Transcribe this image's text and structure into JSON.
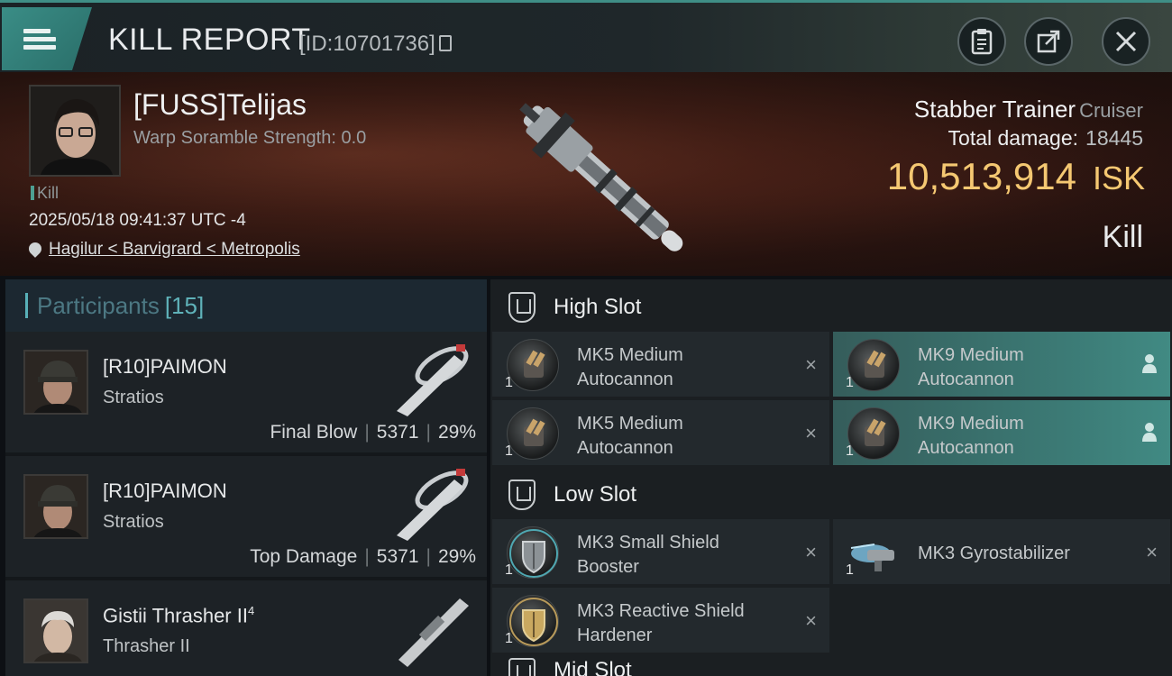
{
  "header": {
    "title": "KILL REPORT",
    "kill_id": "[ID:10701736]"
  },
  "victim": {
    "name": "[FUSS]Telijas",
    "warp_scramble": "Warp Soramble Strength: 0.0",
    "tag": "Kill",
    "time": "2025/05/18 09:41:37 UTC -4",
    "location": "Hagilur < Barvigrard < Metropolis",
    "ship_name": "Stabber Trainer",
    "ship_class": "Cruiser",
    "total_damage_label": "Total damage:",
    "total_damage": "18445",
    "isk_value": "10,513,914",
    "isk_unit": "ISK",
    "result": "Kill"
  },
  "participants": {
    "label": "Participants",
    "count": "[15]",
    "rows": [
      {
        "name": "[R10]PAIMON",
        "ship": "Stratios",
        "role": "Final Blow",
        "damage": "5371",
        "percent": "29%"
      },
      {
        "name": "[R10]PAIMON",
        "ship": "Stratios",
        "role": "Top Damage",
        "damage": "5371",
        "percent": "29%"
      },
      {
        "name": "Gistii Thrasher II",
        "sup": "4",
        "ship": "Thrasher II"
      }
    ]
  },
  "fitting": {
    "high_slot_label": "High Slot",
    "low_slot_label": "Low Slot",
    "mid_slot_label": "Mid Slot",
    "high": [
      {
        "name": "MK5 Medium Autocannon",
        "line1": "MK5 Medium",
        "line2": "Autocannon",
        "qty": "1",
        "state": "destroyed"
      },
      {
        "name": "MK9 Medium Autocannon",
        "line1": "MK9 Medium",
        "line2": "Autocannon",
        "qty": "1",
        "state": "dropped"
      },
      {
        "name": "MK5 Medium Autocannon",
        "line1": "MK5 Medium",
        "line2": "Autocannon",
        "qty": "1",
        "state": "destroyed"
      },
      {
        "name": "MK9 Medium Autocannon",
        "line1": "MK9 Medium",
        "line2": "Autocannon",
        "qty": "1",
        "state": "dropped"
      }
    ],
    "low": [
      {
        "line1": "MK3 Small Shield",
        "line2": "Booster",
        "qty": "1",
        "state": "destroyed"
      },
      {
        "line1": "MK3 Gyrostabilizer",
        "line2": "",
        "qty": "1",
        "state": "destroyed"
      },
      {
        "line1": "MK3 Reactive Shield",
        "line2": "Hardener",
        "qty": "1",
        "state": "destroyed"
      }
    ]
  },
  "icons": {
    "menu": "hamburger-menu-icon",
    "copy": "copy-icon",
    "clipboard": "clipboard-icon",
    "share": "share-icon",
    "close": "close-icon",
    "pin": "location-pin-icon",
    "destroyed": "×",
    "dropped": "person-icon"
  },
  "colors": {
    "accent": "#3f8e86",
    "isk": "#f5c872",
    "active_module": "#3c7b76"
  }
}
